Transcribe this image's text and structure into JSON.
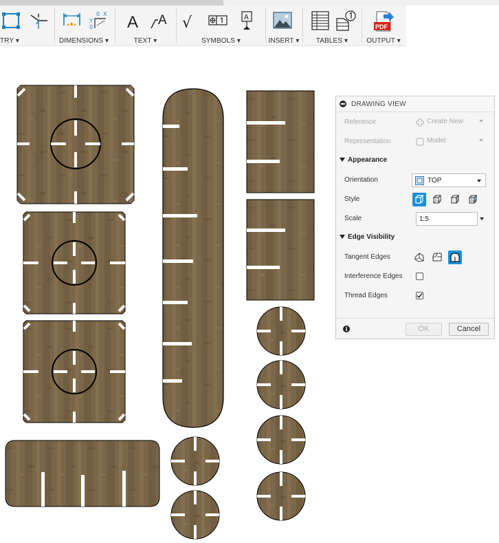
{
  "toolbar": {
    "groups": [
      {
        "label": "TRY",
        "icons": [
          "geometry-nodes-icon",
          "leader-line-icon"
        ]
      },
      {
        "label": "DIMENSIONS",
        "icons": [
          "dimension-icon",
          "ordinate-dimension-icon"
        ]
      },
      {
        "label": "TEXT",
        "icons": [
          "text-icon",
          "leader-text-icon"
        ]
      },
      {
        "label": "SYMBOLS",
        "icons": [
          "surface-texture-icon",
          "feature-control-frame-icon",
          "datum-identifier-icon"
        ]
      },
      {
        "label": "INSERT",
        "icons": [
          "insert-image-icon"
        ]
      },
      {
        "label": "TABLES",
        "icons": [
          "table-icon",
          "balloon-icon"
        ]
      },
      {
        "label": "OUTPUT",
        "icons": [
          "pdf-output-icon"
        ]
      }
    ],
    "pdf_badge": "PDF",
    "text_glyph": "A",
    "check_glyph": "√"
  },
  "panel": {
    "title": "DRAWING VIEW",
    "reference": {
      "label": "Reference",
      "value": "Create New"
    },
    "representation": {
      "label": "Representation",
      "value": "Model"
    },
    "appearance": {
      "title": "Appearance"
    },
    "orientation": {
      "label": "Orientation",
      "value": "TOP"
    },
    "style": {
      "label": "Style",
      "options": [
        "visible-edges-icon",
        "visible-hidden-edges-icon",
        "shaded-icon",
        "shaded-hidden-edges-icon"
      ],
      "selected": 0
    },
    "scale": {
      "label": "Scale",
      "value": "1:5"
    },
    "edge_visibility": {
      "title": "Edge Visibility"
    },
    "tangent_edges": {
      "label": "Tangent Edges",
      "options": [
        "off-icon",
        "full-length-icon",
        "shortened-icon"
      ],
      "selected": 2
    },
    "interference_edges": {
      "label": "Interference Edges",
      "checked": false
    },
    "thread_edges": {
      "label": "Thread Edges",
      "checked": true
    },
    "info_glyph": "i",
    "ok_label": "OK",
    "cancel_label": "Cancel"
  },
  "colors": {
    "accent": "#1a8fd8",
    "wood": "#7a6648",
    "wood_dark": "#5e4c33",
    "outline": "#000000"
  }
}
